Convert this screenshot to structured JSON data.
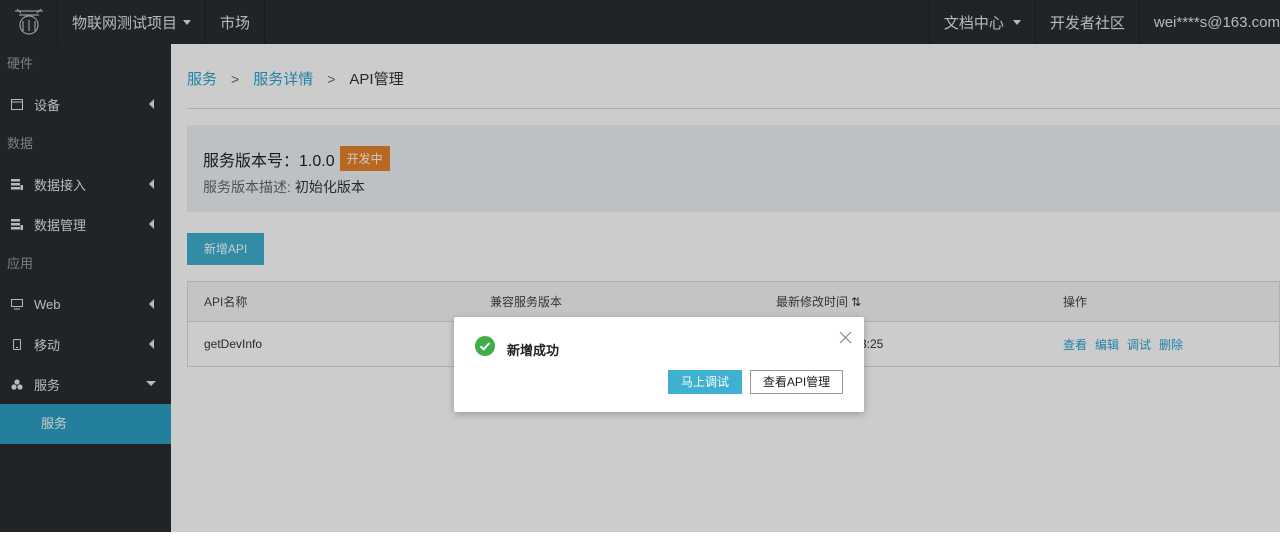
{
  "topbar": {
    "project": "物联网测试项目",
    "market": "市场",
    "docs": "文档中心",
    "community": "开发者社区",
    "user": "wei****s@163.com"
  },
  "sidebar": {
    "sections": {
      "hardware": "硬件",
      "data": "数据",
      "app": "应用"
    },
    "items": {
      "device": "设备",
      "data_access": "数据接入",
      "data_manage": "数据管理",
      "web": "Web",
      "mobile": "移动",
      "service": "服务"
    },
    "sub_service": "服务"
  },
  "breadcrumb": {
    "level1": "服务",
    "level2": "服务详情",
    "current": "API管理",
    "separator": ">"
  },
  "version": {
    "title": "服务版本号：1.0.0",
    "status": "开发中",
    "desc_label": "服务版本描述:",
    "desc_value": "初始化版本"
  },
  "add_api_label": "新增API",
  "table": {
    "headers": {
      "name": "API名称",
      "compat": "兼容服务版本",
      "modified": "最新修改时间",
      "ops": "操作"
    },
    "row": {
      "name": "getDevInfo",
      "modified_visible": "3:25",
      "ops": {
        "view": "查看",
        "edit": "编辑",
        "debug": "调试",
        "delete": "删除"
      }
    }
  },
  "modal": {
    "message": "新增成功",
    "primary": "马上调试",
    "secondary": "查看API管理"
  },
  "colors": {
    "accent": "#3fb0cf",
    "link": "#2aa3d2",
    "badge": "#e8822a",
    "sidebar": "#2a2d30",
    "success": "#3fae49"
  }
}
